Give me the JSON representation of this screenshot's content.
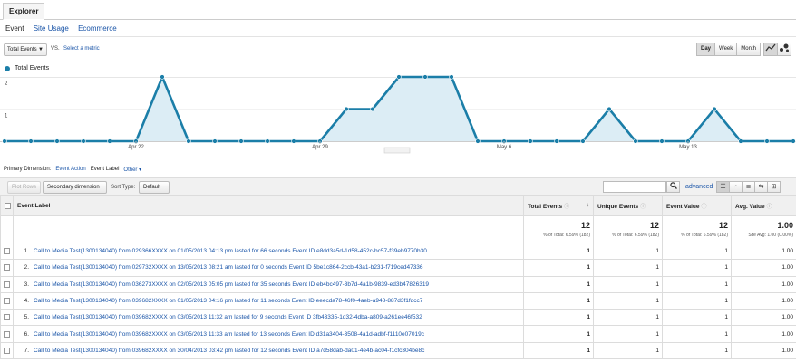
{
  "explorer_tab": "Explorer",
  "subtabs": [
    "Event",
    "Site Usage",
    "Ecommerce"
  ],
  "metric": {
    "selected": "Total Events",
    "vs": "VS.",
    "select_metric": "Select a metric"
  },
  "granularity": [
    "Day",
    "Week",
    "Month"
  ],
  "granularity_active": "Day",
  "chart_icons": [
    "line-chart-icon",
    "motion-chart-icon"
  ],
  "legend_label": "Total Events",
  "colors": {
    "series": "#1b7ea8",
    "fill": "#dcedf5",
    "link": "#1a55a8"
  },
  "chart_data": {
    "type": "area",
    "series": [
      {
        "name": "Total Events",
        "values": [
          0,
          0,
          0,
          0,
          0,
          0,
          2,
          0,
          0,
          0,
          0,
          0,
          0,
          1,
          1,
          2,
          2,
          2,
          0,
          0,
          0,
          0,
          0,
          1,
          0,
          0,
          0,
          1,
          0,
          0,
          0
        ]
      }
    ],
    "ylim": [
      0,
      2
    ],
    "yticks": [
      "2",
      "1"
    ],
    "xticks": [
      {
        "label": "Apr 22",
        "index": 5
      },
      {
        "label": "Apr 29",
        "index": 12
      },
      {
        "label": "May 6",
        "index": 19
      },
      {
        "label": "May 13",
        "index": 26
      }
    ],
    "grid": true
  },
  "primary_dimension": {
    "label": "Primary Dimension:",
    "options": [
      "Event Action",
      "Event Label",
      "Other"
    ],
    "current": "Event Label"
  },
  "toolbar": {
    "plot_rows": "Plot Rows",
    "secondary_dimension": "Secondary dimension",
    "sort_type_label": "Sort Type:",
    "sort_type_value": "Default",
    "advanced": "advanced",
    "search_placeholder": ""
  },
  "table": {
    "headers": {
      "label": "Event Label",
      "total_events": "Total Events",
      "unique_events": "Unique Events",
      "event_value": "Event Value",
      "avg_value": "Avg. Value"
    },
    "totals": {
      "total_events": "12",
      "total_events_sub": "% of Total: 6.59% (182)",
      "unique_events": "12",
      "unique_events_sub": "% of Total: 6.59% (182)",
      "event_value": "12",
      "event_value_sub": "% of Total: 6.59% (182)",
      "avg_value": "1.00",
      "avg_value_sub": "Site Avg: 1.00 (0.00%)"
    },
    "rows": [
      {
        "n": "1.",
        "label": "Call to Media Test(1300134040) from 029366XXXX on 01/05/2013 04:13 pm lasted for 66 seconds Event ID e8dd3a5d-1d58-452c-bc57-f39eb9770b30",
        "total": "1",
        "unique": "1",
        "value": "1",
        "avg": "1.00"
      },
      {
        "n": "2.",
        "label": "Call to Media Test(1300134040) from 029732XXXX on 13/05/2013 08:21 am lasted for 0 seconds Event ID 5be1c864-2ccb-43a1-b231-f719ced47336",
        "total": "1",
        "unique": "1",
        "value": "1",
        "avg": "1.00"
      },
      {
        "n": "3.",
        "label": "Call to Media Test(1300134040) from 036273XXXX on 02/05/2013 05:05 pm lasted for 35 seconds Event ID eb4bc497-3b7d-4a1b-9839-ed3b47826319",
        "total": "1",
        "unique": "1",
        "value": "1",
        "avg": "1.00"
      },
      {
        "n": "4.",
        "label": "Call to Media Test(1300134040) from 039682XXXX on 01/05/2013 04:16 pm lasted for 11 seconds Event ID eeecda78-46f0-4aeb-a948-887d3f1fdcc7",
        "total": "1",
        "unique": "1",
        "value": "1",
        "avg": "1.00"
      },
      {
        "n": "5.",
        "label": "Call to Media Test(1300134040) from 039682XXXX on 03/05/2013 11:32 am lasted for 9 seconds Event ID 3fb43335-1d32-4dba-a809-a261ee46f532",
        "total": "1",
        "unique": "1",
        "value": "1",
        "avg": "1.00"
      },
      {
        "n": "6.",
        "label": "Call to Media Test(1300134040) from 039682XXXX on 03/05/2013 11:33 am lasted for 13 seconds Event ID d31a3404-3508-4a1d-adbf-f1110e07019c",
        "total": "1",
        "unique": "1",
        "value": "1",
        "avg": "1.00"
      },
      {
        "n": "7.",
        "label": "Call to Media Test(1300134040) from 039682XXXX on 30/04/2013 03:42 pm lasted for 12 seconds Event ID a7d58dab-da01-4e4b-ac04-f1cfc304be8c",
        "total": "1",
        "unique": "1",
        "value": "1",
        "avg": "1.00"
      }
    ]
  }
}
